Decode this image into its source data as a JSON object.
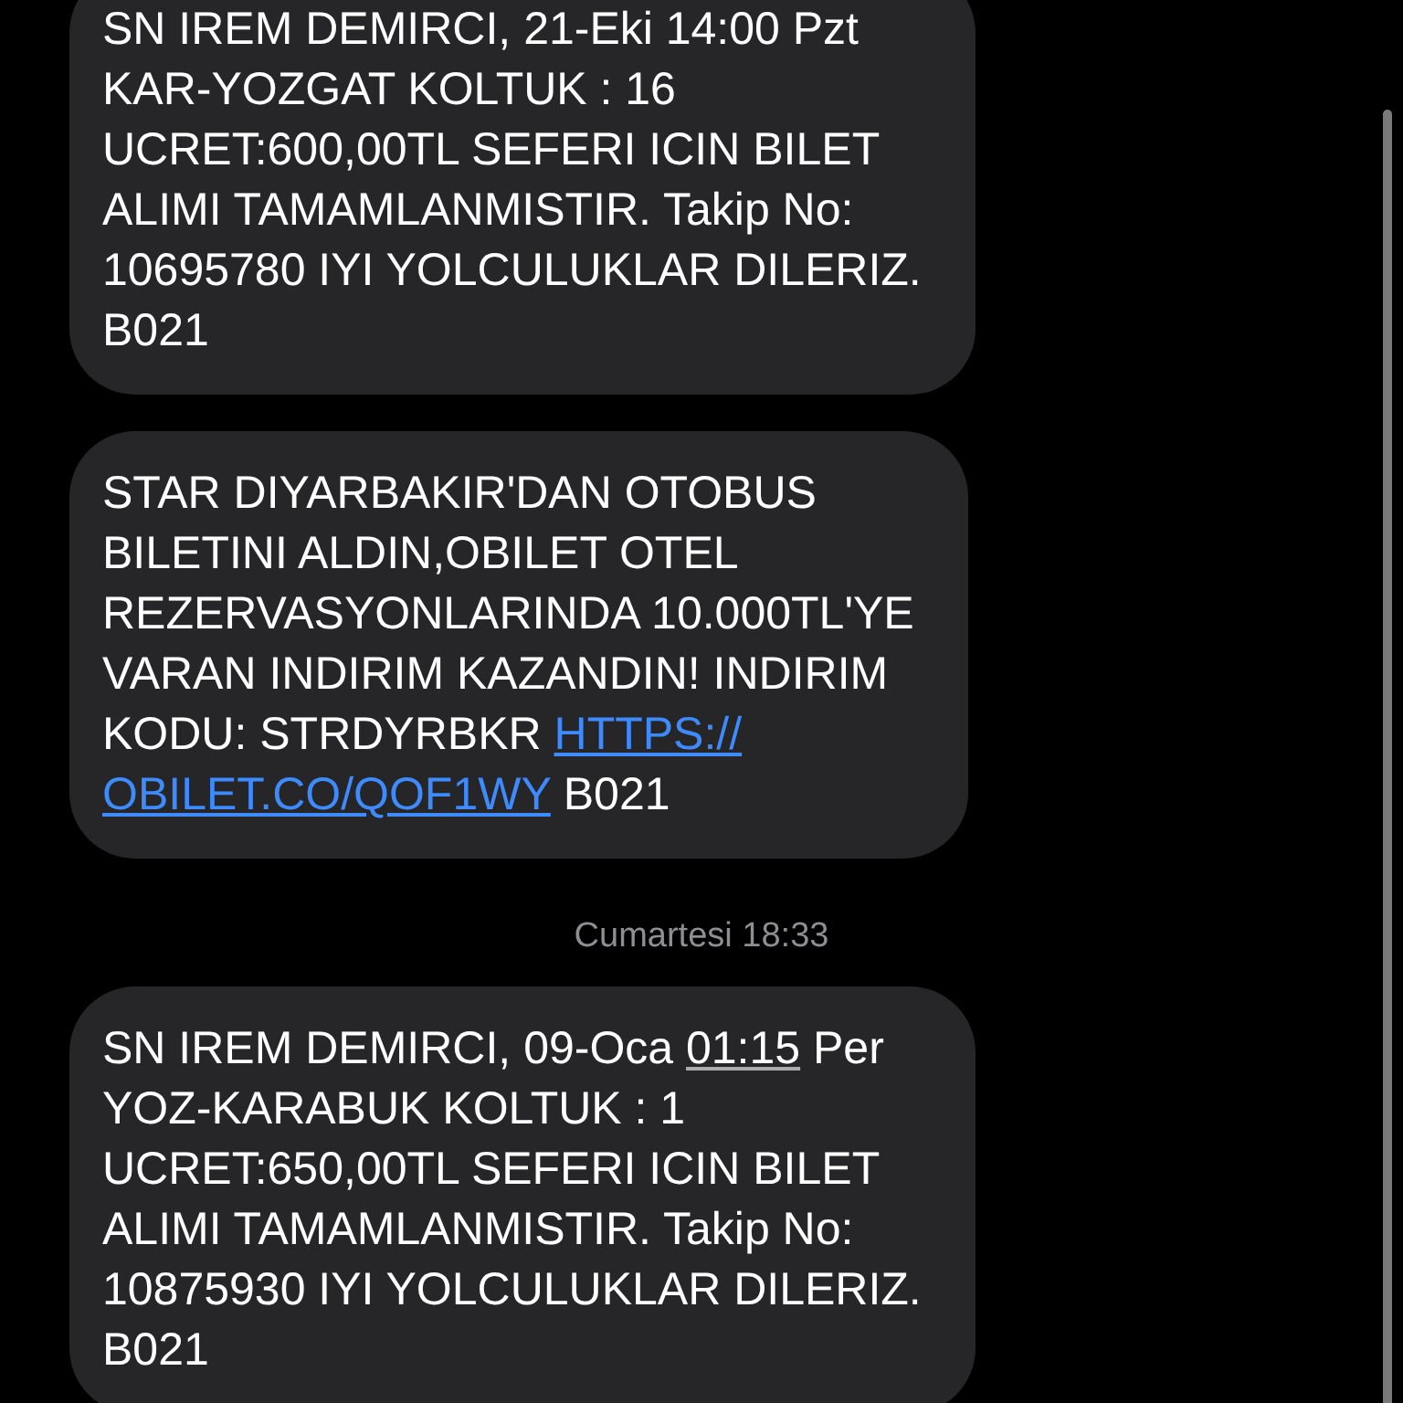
{
  "thread": [
    {
      "kind": "message",
      "lines": [
        [
          {
            "kind": "text",
            "text": "SN IREM DEMIRCI, 21-Eki 14:00 Pzt"
          }
        ],
        [
          {
            "kind": "text",
            "text": "KAR-YOZGAT KOLTUK : 16"
          }
        ],
        [
          {
            "kind": "text",
            "text": "UCRET:600,00TL SEFERI ICIN BILET"
          }
        ],
        [
          {
            "kind": "text",
            "text": "ALIMI TAMAMLANMISTIR. Takip No:"
          }
        ],
        [
          {
            "kind": "text",
            "text": "10695780 IYI YOLCULUKLAR DILERIZ."
          }
        ],
        [
          {
            "kind": "text",
            "text": "B021"
          }
        ]
      ]
    },
    {
      "kind": "message",
      "lines": [
        [
          {
            "kind": "text",
            "text": "STAR DIYARBAKIR'DAN OTOBUS"
          }
        ],
        [
          {
            "kind": "text",
            "text": "BILETINI ALDIN,OBILET OTEL"
          }
        ],
        [
          {
            "kind": "text",
            "text": "REZERVASYONLARINDA 10.000TL'YE"
          }
        ],
        [
          {
            "kind": "text",
            "text": "VARAN INDIRIM KAZANDIN! INDIRIM"
          }
        ],
        [
          {
            "kind": "text",
            "text": "KODU: STRDYRBKR "
          },
          {
            "kind": "link",
            "text": "HTTPS://"
          }
        ],
        [
          {
            "kind": "link",
            "text": "OBILET.CO/QOF1WY"
          },
          {
            "kind": "text",
            "text": " B021"
          }
        ]
      ]
    },
    {
      "kind": "timestamp",
      "day": "Cumartesi",
      "time": "18:33"
    },
    {
      "kind": "message",
      "lines": [
        [
          {
            "kind": "text",
            "text": "SN IREM DEMIRCI, 09-Oca "
          },
          {
            "kind": "detected",
            "text": "01:15"
          },
          {
            "kind": "text",
            "text": " Per"
          }
        ],
        [
          {
            "kind": "text",
            "text": "YOZ-KARABUK KOLTUK : 1"
          }
        ],
        [
          {
            "kind": "text",
            "text": "UCRET:650,00TL SEFERI ICIN BILET"
          }
        ],
        [
          {
            "kind": "text",
            "text": "ALIMI TAMAMLANMISTIR. Takip No:"
          }
        ],
        [
          {
            "kind": "text",
            "text": "10875930 IYI YOLCULUKLAR DILERIZ."
          }
        ],
        [
          {
            "kind": "text",
            "text": "B021"
          }
        ]
      ]
    }
  ]
}
